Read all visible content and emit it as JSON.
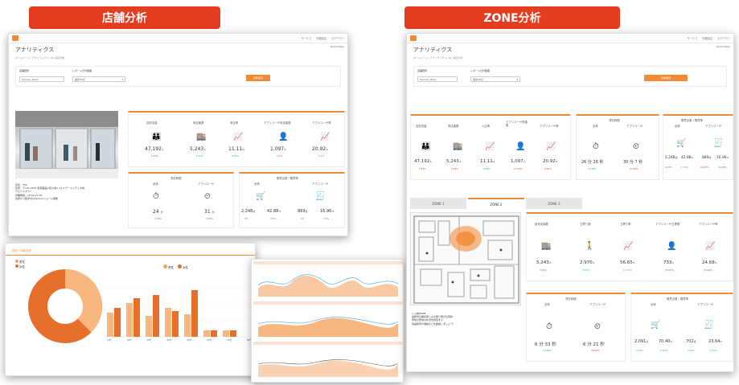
{
  "banners": {
    "left": "店舗分析",
    "right": "ZONE分析"
  },
  "topnav": [
    "サービス",
    "情報設定",
    "ログアウト"
  ],
  "page": {
    "title": "アナリティクス",
    "breadcrumb": "ホームページ / アナリティクス / RA 来店分析",
    "user": "HylonoTeec"
  },
  "filter": {
    "store_label": "店舗選択",
    "store_value": "Service_Store",
    "period_label": "レポート日付範囲",
    "period_value": "過去30日",
    "search_btn": "条件検索"
  },
  "store_info": [
    "店名：TEC",
    "住所：〒141-0032 東京都品川区大崎1-11-1 ゲートシティ大崎",
    "ウエストタワー",
    "営業時間：10:00-21:00",
    "住所から徒歩3分のsunyxショール開催"
  ],
  "left": {
    "visitor_card": {
      "headers": [
        "店前流量",
        "来店客数",
        "来店率",
        "アプリユーザ来店客数",
        "アプリユーザ率"
      ],
      "values": [
        "47,192",
        "5,243",
        "11.11",
        "1,097",
        "20.92"
      ],
      "units": [
        "人",
        "人",
        "%",
        "人",
        "%"
      ],
      "changes": [
        "0.14%",
        "0.14%",
        "0.00%",
        "1.2%",
        "1.2%"
      ]
    },
    "stay_card": {
      "title": "滞在時間",
      "headers": [
        "全体",
        "アプリユーザ"
      ],
      "values": [
        "24",
        "31"
      ],
      "units": [
        "分",
        "分"
      ],
      "changes": [
        "2.25%",
        "3.25%"
      ]
    },
    "purchase_card": {
      "title": "購買点数 / 購買率",
      "headers": [
        "全体",
        "アプリユーザ"
      ],
      "values": [
        "2,248",
        "42.88",
        "889",
        "16.96"
      ],
      "units": [
        "点",
        "%",
        "点",
        "%"
      ],
      "changes": [
        "3%",
        "7.5%",
        "3%",
        "7.5%"
      ]
    }
  },
  "bottom_panel": {
    "title": "性別・年齢分析",
    "pie_legend": [
      "男性",
      "女性"
    ],
    "bar_legend": [
      "男性",
      "女性"
    ],
    "bar_categories": [
      "10代",
      "20代",
      "30代",
      "40代",
      "50代",
      "60代",
      "70代",
      "80代"
    ]
  },
  "right": {
    "visitor_card": {
      "headers": [
        "店前流量",
        "来店客数",
        "入店率",
        "アプリユーザ来客数",
        "アプリユーザ率"
      ],
      "values": [
        "47,192",
        "5,243",
        "11.11",
        "1,097",
        "20.92"
      ],
      "units": [
        "人",
        "人",
        "%",
        "人",
        "%"
      ],
      "changes": [
        "1.81%",
        "5.93%",
        "0.00%",
        "17.05%",
        "6.20%"
      ]
    },
    "stay_card": {
      "title": "滞在時間",
      "headers": [
        "全体",
        "アプリユーザ"
      ],
      "values": [
        "26 分 26 秒",
        "30 分 7 秒"
      ],
      "changes": [
        "19.95%",
        "27.59%"
      ]
    },
    "purchase_card": {
      "title": "購買点数 / 購買率",
      "headers": [
        "全体",
        "アプリユーザ"
      ],
      "values": [
        "2,248",
        "42.88",
        "889",
        "16.96"
      ],
      "units": [
        "点",
        "%",
        "点",
        "%"
      ],
      "changes": [
        "4.07%",
        "1.70%",
        "19.67%",
        "15.49%"
      ]
    },
    "tabs": [
      "ZONE 1",
      "ZONE 2",
      "ZONE 3"
    ],
    "zone_card": {
      "headers": [
        "前来店客数",
        "立寄り数",
        "立寄り率",
        "アプリユーザ立寄数",
        "アプリユーザ率"
      ],
      "values": [
        "5,243",
        "2,970",
        "56.65",
        "733",
        "24.68"
      ],
      "units": [
        "人",
        "人",
        "%",
        "人",
        "%"
      ],
      "changes": [
        "5.49%",
        "8.51%",
        "13.73%",
        "23.67%",
        "35.64%"
      ]
    },
    "zone_stay": {
      "title": "滞在時間",
      "headers": [
        "全体",
        "アプリユーザ"
      ],
      "values": [
        "6 分 33 秒",
        "6 分 21 秒"
      ],
      "changes": [
        "10.00%",
        "26.42%"
      ]
    },
    "zone_purchase": {
      "title": "購買点数 / 購買率",
      "headers": [
        "全体",
        "アプリユーザ"
      ],
      "values": [
        "2,091",
        "70.40",
        "702",
        "23.64"
      ],
      "units": [
        "点",
        "%",
        "点",
        "%"
      ],
      "changes": [
        "3.03%",
        "5.54%",
        "3.03%",
        "5.51%"
      ]
    },
    "zone_note": [
      "レジ前ZONE",
      "最終列の購買率と立ち寄り率が比較的",
      "売場の売場の状況を調査する",
      "商品陳列や価格などを確認しましょう！"
    ]
  },
  "colors": {
    "accent": "#f08a35",
    "banner": "#e43c1f",
    "up": "#d9452f",
    "down": "#3a8fd9"
  }
}
